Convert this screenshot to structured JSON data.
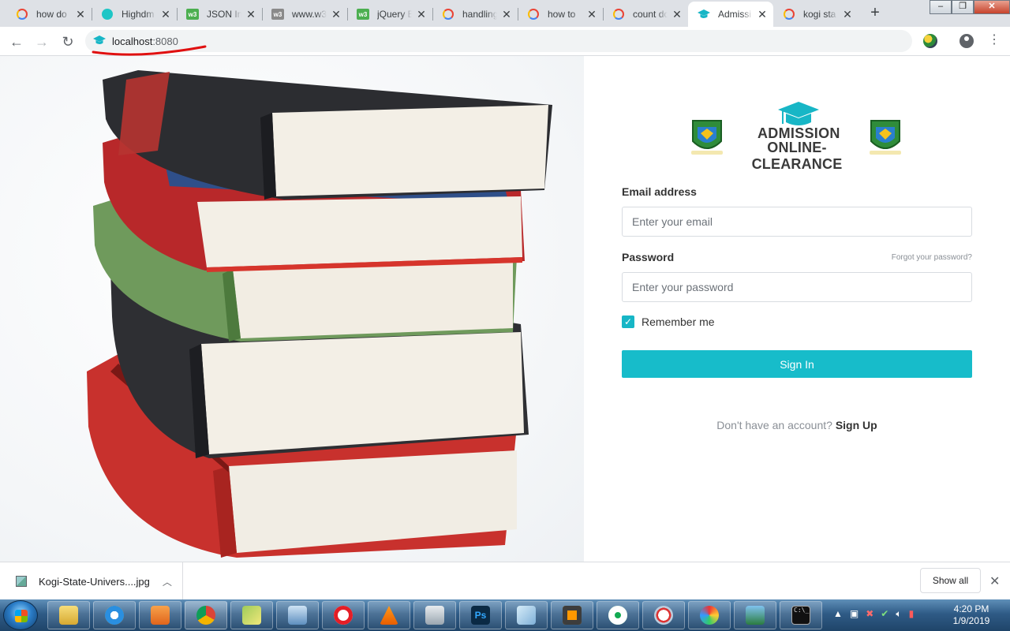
{
  "browser": {
    "tabs": [
      {
        "title": "how do",
        "icon": "google-icon",
        "active": false
      },
      {
        "title": "Highdm",
        "icon": "highcharts-icon",
        "active": false
      },
      {
        "title": "JSON In",
        "icon": "w3schools-icon",
        "active": false
      },
      {
        "title": "www.w3",
        "icon": "w3schools-icon",
        "active": false
      },
      {
        "title": "jQuery E",
        "icon": "w3schools-icon",
        "active": false
      },
      {
        "title": "handling",
        "icon": "google-icon",
        "active": false
      },
      {
        "title": "how to",
        "icon": "google-icon",
        "active": false
      },
      {
        "title": "count do",
        "icon": "google-icon",
        "active": false
      },
      {
        "title": "Admissi",
        "icon": "graduation-cap-icon",
        "active": true
      },
      {
        "title": "kogi sta",
        "icon": "google-icon",
        "active": false
      }
    ],
    "url_host": "localhost",
    "url_port": ":8080",
    "accent": "#17b6c6"
  },
  "login": {
    "logo_line1": "ADMISSION",
    "logo_line2": "ONLINE-CLEARANCE",
    "email_label": "Email address",
    "email_placeholder": "Enter your email",
    "password_label": "Password",
    "forgot_link": "Forgot your password?",
    "password_placeholder": "Enter your password",
    "remember_label": "Remember me",
    "remember_checked": true,
    "signin_label": "Sign In",
    "signup_prompt": "Don't have an account?",
    "signup_link": "Sign Up",
    "button_color": "#17bcca"
  },
  "downloads": {
    "file_name": "Kogi-State-Univers....jpg",
    "show_all_label": "Show all"
  },
  "taskbar": {
    "time": "4:20 PM",
    "date": "1/9/2019"
  },
  "colors": {
    "accent": "#17b6c6",
    "annotation": "#e01010"
  }
}
